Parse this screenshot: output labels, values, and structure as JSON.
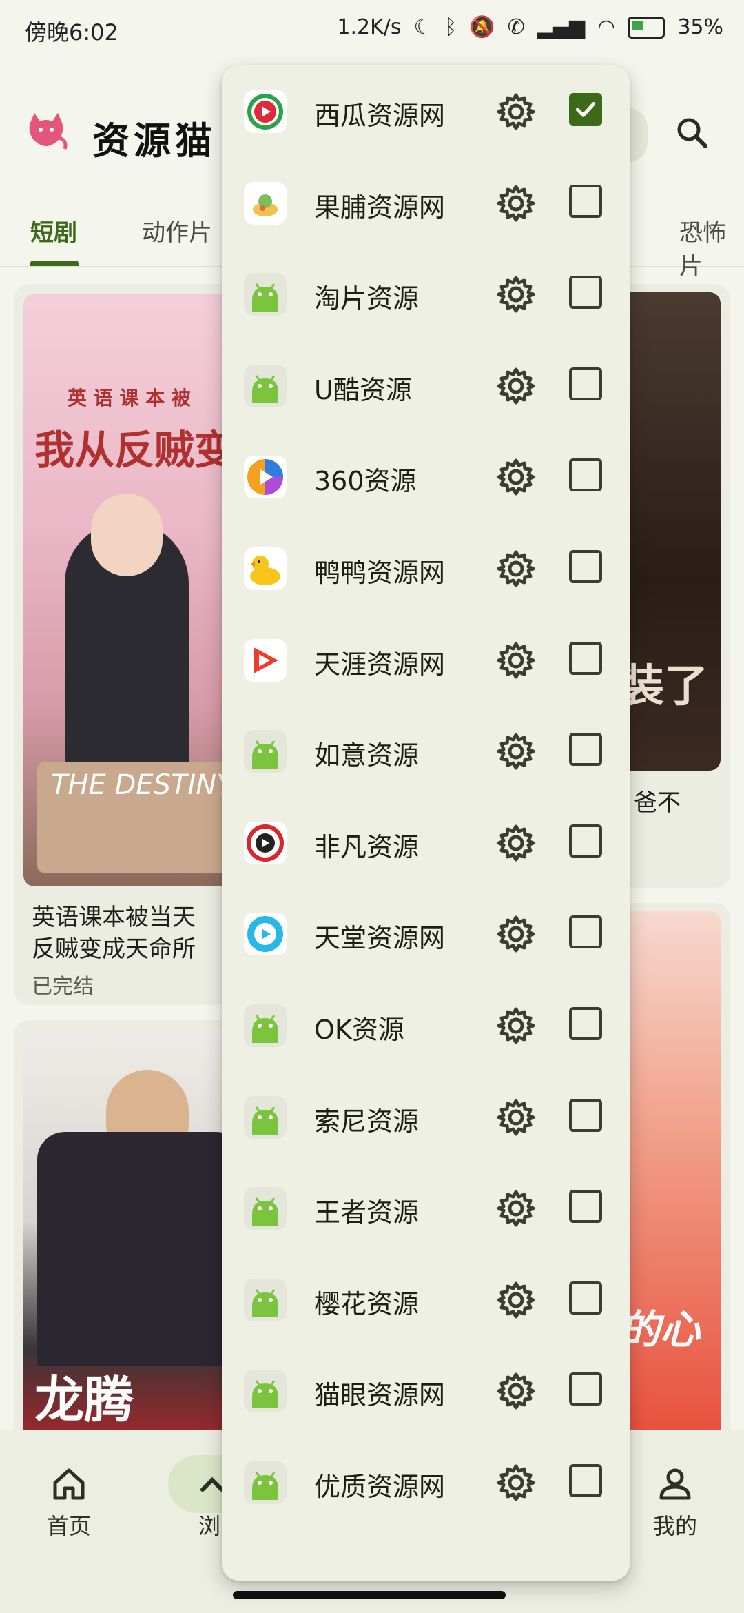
{
  "status_bar": {
    "time": "傍晚6:02",
    "net_speed": "1.2K/s",
    "battery": "35%"
  },
  "app": {
    "brand": "资源猫"
  },
  "tabs": [
    {
      "label": "短剧",
      "active": true
    },
    {
      "label": "动作片",
      "active": false
    },
    {
      "label": "恐怖片",
      "active": false
    }
  ],
  "cards": [
    {
      "title_line1": "英语课本被当天",
      "title_line2": "反贼变成天命所",
      "status": "已完结"
    },
    {
      "title_partial": "爸不"
    }
  ],
  "poster_texts": {
    "p1_top": "英 语 课 本 被",
    "p1_main": "我从反贼变成",
    "p1_script": "THE DESTINY",
    "p2_main": "装了",
    "p3_main": "龙腾",
    "p4_main": "的心"
  },
  "bottom_nav": {
    "home": "首页",
    "browse": "浏",
    "mine": "我的"
  },
  "menu": {
    "items": [
      {
        "name": "西瓜资源网",
        "icon": "xigua-icon",
        "checked": true
      },
      {
        "name": "果脯资源网",
        "icon": "guofu-icon",
        "checked": false
      },
      {
        "name": "淘片资源",
        "icon": "android-icon",
        "checked": false
      },
      {
        "name": "U酷资源",
        "icon": "android-icon",
        "checked": false
      },
      {
        "name": "360资源",
        "icon": "360-icon",
        "checked": false
      },
      {
        "name": "鸭鸭资源网",
        "icon": "duck-icon",
        "checked": false
      },
      {
        "name": "天涯资源网",
        "icon": "tianya-icon",
        "checked": false
      },
      {
        "name": "如意资源",
        "icon": "android-icon",
        "checked": false
      },
      {
        "name": "非凡资源",
        "icon": "feifan-icon",
        "checked": false
      },
      {
        "name": "天堂资源网",
        "icon": "tiantang-icon",
        "checked": false
      },
      {
        "name": "OK资源",
        "icon": "android-icon",
        "checked": false
      },
      {
        "name": "索尼资源",
        "icon": "android-icon",
        "checked": false
      },
      {
        "name": "王者资源",
        "icon": "android-icon",
        "checked": false
      },
      {
        "name": "樱花资源",
        "icon": "android-icon",
        "checked": false
      },
      {
        "name": "猫眼资源网",
        "icon": "android-icon",
        "checked": false
      },
      {
        "name": "优质资源网",
        "icon": "android-icon",
        "checked": false
      }
    ]
  },
  "colors": {
    "accent": "#3d6a19",
    "background": "#f4f5ec",
    "menu_bg": "#eef0e4"
  }
}
